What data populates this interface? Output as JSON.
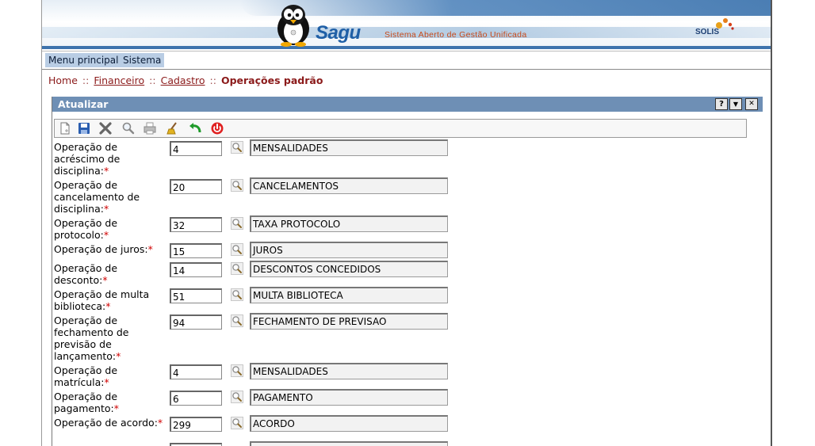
{
  "header": {
    "brand": "Sagu",
    "tagline": "Sistema Aberto de Gestão Unificada",
    "partner_logo": "SOLIS"
  },
  "menu": [
    {
      "label": "Menu principal"
    },
    {
      "label": "Sistema"
    }
  ],
  "breadcrumb": {
    "home": "Home",
    "items": [
      "Financeiro",
      "Cadastro"
    ],
    "separator": "::",
    "current": "Operações padrão"
  },
  "panel": {
    "title": "Atualizar",
    "window_buttons": [
      "?",
      "▼",
      "✕"
    ],
    "toolbar": [
      "new-document-icon",
      "save-icon",
      "delete-icon",
      "search-icon",
      "print-icon",
      "clear-icon",
      "back-icon",
      "exit-icon"
    ]
  },
  "form": {
    "rows": [
      {
        "label": "Operação de acréscimo de disciplina:",
        "code": "4",
        "desc": "MENSALIDADES"
      },
      {
        "label": "Operação de cancelamento de disciplina:",
        "code": "20",
        "desc": "CANCELAMENTOS"
      },
      {
        "label": "Operação de protocolo:",
        "code": "32",
        "desc": "TAXA PROTOCOLO"
      },
      {
        "label": "Operação de juros:",
        "code": "15",
        "desc": "JUROS"
      },
      {
        "label": "Operação de desconto:",
        "code": "14",
        "desc": "DESCONTOS CONCEDIDOS"
      },
      {
        "label": "Operação de multa biblioteca:",
        "code": "51",
        "desc": "MULTA BIBLIOTECA"
      },
      {
        "label": "Operação de fechamento de previsão de lançamento:",
        "code": "94",
        "desc": "FECHAMENTO DE PREVISAO"
      },
      {
        "label": "Operação de matrícula:",
        "code": "4",
        "desc": "MENSALIDADES"
      },
      {
        "label": "Operação de pagamento:",
        "code": "6",
        "desc": "PAGAMENTO"
      },
      {
        "label": "Operação de acordo:",
        "code": "299",
        "desc": "ACORDO"
      }
    ],
    "required_mark": "*"
  },
  "colors": {
    "panel_title_bg": "#6e8fb5",
    "menu_bg": "#b9cde4",
    "breadcrumb": "#8b1a1a",
    "required": "#d00000"
  }
}
